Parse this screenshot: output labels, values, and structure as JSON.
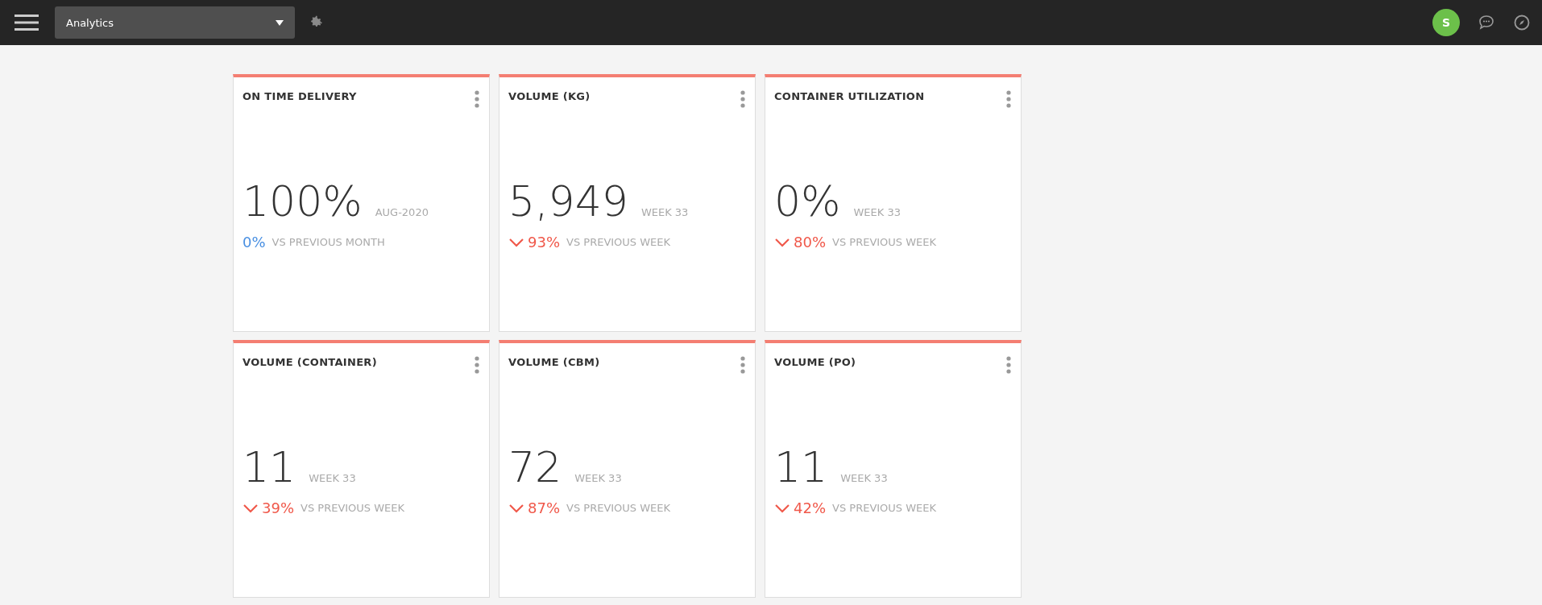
{
  "top_bar": {
    "dashboard_select": {
      "value": "Analytics"
    },
    "avatar": {
      "initial": "S"
    }
  },
  "cards": [
    {
      "title": "ON TIME DELIVERY",
      "value": "100%",
      "period": "AUG-2020",
      "change": "0%",
      "kind": "neutral",
      "comparison": "VS PREVIOUS MONTH"
    },
    {
      "title": "VOLUME (KG)",
      "value": "5,949",
      "period": "WEEK 33",
      "change": "93%",
      "kind": "decrease",
      "comparison": "VS PREVIOUS WEEK"
    },
    {
      "title": "CONTAINER UTILIZATION",
      "value": "0%",
      "period": "WEEK 33",
      "change": "80%",
      "kind": "decrease",
      "comparison": "VS PREVIOUS WEEK"
    },
    {
      "title": "VOLUME (CONTAINER)",
      "value": "11",
      "period": "WEEK 33",
      "change": "39%",
      "kind": "decrease",
      "comparison": "VS PREVIOUS WEEK"
    },
    {
      "title": "VOLUME (CBM)",
      "value": "72",
      "period": "WEEK 33",
      "change": "87%",
      "kind": "decrease",
      "comparison": "VS PREVIOUS WEEK"
    },
    {
      "title": "VOLUME (PO)",
      "value": "11",
      "period": "WEEK 33",
      "change": "42%",
      "kind": "decrease",
      "comparison": "VS PREVIOUS WEEK"
    }
  ]
}
